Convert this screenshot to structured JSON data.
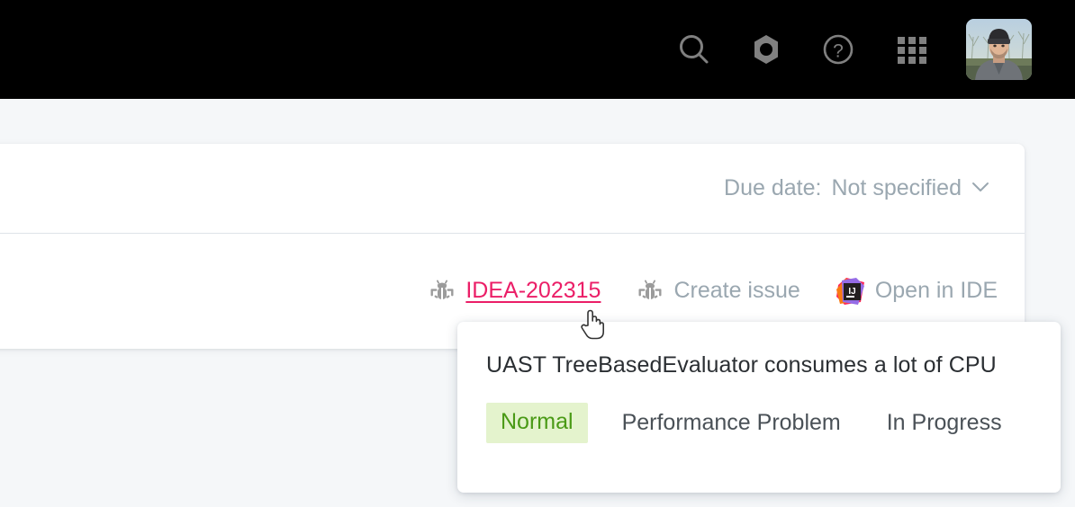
{
  "topbar": {
    "background": "#000000",
    "icons": [
      {
        "name": "search-icon",
        "label": "Search"
      },
      {
        "name": "settings-nut-icon",
        "label": "Settings"
      },
      {
        "name": "help-icon",
        "label": "Help"
      },
      {
        "name": "apps-grid-icon",
        "label": "Applications"
      }
    ],
    "avatar": {
      "name": "user-avatar",
      "label": "User profile"
    }
  },
  "card": {
    "due_date": {
      "label": "Due date:",
      "value": "Not specified",
      "chevron": "⌄"
    },
    "links": [
      {
        "icon": "bug-icon",
        "label": "IDEA-202315",
        "style": "issue"
      },
      {
        "icon": "bug-icon",
        "label": "Create issue",
        "style": "muted"
      },
      {
        "icon": "intellij-idea-icon",
        "label": "Open in IDE",
        "style": "muted"
      }
    ]
  },
  "popup": {
    "title": "UAST TreeBasedEvaluator consumes a lot of CPU",
    "priority": "Normal",
    "type": "Performance Problem",
    "state": "In Progress",
    "priority_color": "#4a9a16",
    "priority_bg": "#e4f3cd"
  },
  "colors": {
    "page_background": "#f5f7f9",
    "card_background": "#ffffff",
    "link_accent": "#eb1e67",
    "muted_text": "#9aa7b0",
    "divider": "#dfe3e9"
  },
  "cursor": {
    "type": "pointer-hand"
  }
}
